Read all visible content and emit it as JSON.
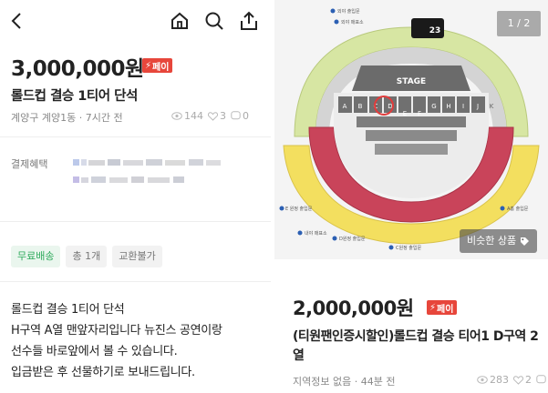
{
  "left": {
    "price": "3,000,000원",
    "pay_badge": "페이",
    "title": "롤드컵 결승 1티어 단석",
    "location": "계양구 계양1동",
    "time": "7시간 전",
    "views": "144",
    "likes": "3",
    "chats": "0",
    "payment_label": "결제혜택",
    "tags": [
      "무료배송",
      "총 1개",
      "교환불가"
    ],
    "description": [
      "롤드컵 결승 1티어 단석",
      "H구역 A열 맨앞자리입니다 뉴진스 공연이랑",
      "선수들 바로앞에서 볼 수 있습니다.",
      "입금받은 후 선물하기로 보내드립니다."
    ]
  },
  "right": {
    "page_indicator": "1 / 2",
    "similar_button": "비슷한 상품",
    "price": "2,000,000원",
    "pay_badge": "페이",
    "title": "(티원팬인증시할인)롤드컵 결승 티어1 D구역 2열",
    "location": "지역정보 없음",
    "time": "44분 전",
    "views": "283",
    "likes": "2",
    "chats": "2",
    "map": {
      "stage_label": "STAGE",
      "section_labels": [
        "A",
        "B",
        "C",
        "D",
        "E",
        "F",
        "G",
        "H",
        "I",
        "J",
        "K"
      ],
      "gate_labels": [
        "E 원정 출입문",
        "A홈 출입문",
        "내야 매표소",
        "D원정 출입문",
        "C원정 출입문",
        "외야 매표소",
        "외야 출입문"
      ],
      "logo_text": "23"
    }
  },
  "colors": {
    "pay_red": "#e7463b",
    "green_tag": "#2eaa5c",
    "highlight_red": "#e23b3b"
  }
}
